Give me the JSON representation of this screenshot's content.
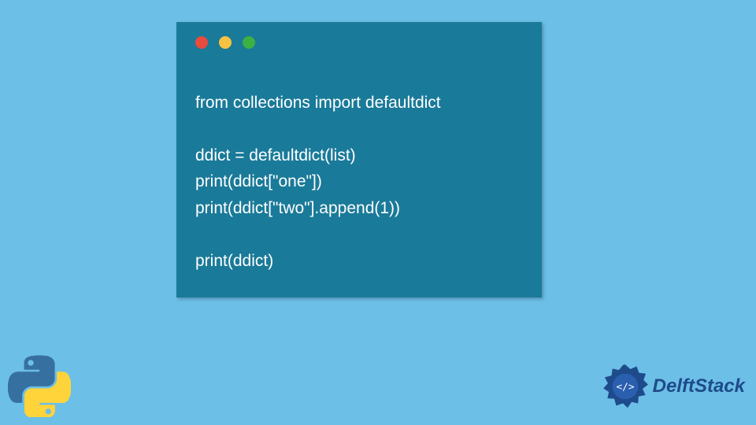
{
  "code": {
    "lines": [
      "from collections import defaultdict",
      "",
      "ddict = defaultdict(list)",
      "print(ddict[\"one\"])",
      "print(ddict[\"two\"].append(1))",
      "",
      "print(ddict)"
    ]
  },
  "brand": {
    "name": "DelftStack"
  },
  "colors": {
    "background": "#6cbfe6",
    "card": "#1a7a99",
    "text": "#ffffff",
    "dot_red": "#e94b3c",
    "dot_yellow": "#f5c242",
    "dot_green": "#3cb043",
    "brand_blue": "#1e4b8b"
  }
}
